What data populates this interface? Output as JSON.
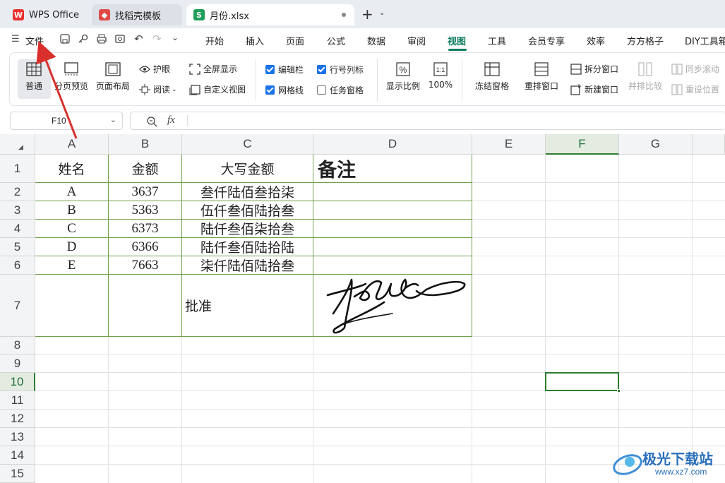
{
  "tabs": [
    {
      "label": "WPS Office",
      "icon": "wps-logo-icon"
    },
    {
      "label": "找稻壳模板",
      "icon": "daoke-icon"
    },
    {
      "label": "月份.xlsx",
      "icon": "sheet-s-icon"
    }
  ],
  "menus": {
    "file": "文件",
    "items": [
      "开始",
      "插入",
      "页面",
      "公式",
      "数据",
      "审阅",
      "视图",
      "工具",
      "会员专享",
      "效率",
      "方方格子",
      "DIY工具箱"
    ],
    "active": "视图"
  },
  "ribbon": {
    "normal": "普通",
    "page_break": "分页预览",
    "page_layout": "页面布局",
    "eye_protect": "护眼",
    "reading": "阅读",
    "fullscreen": "全屏显示",
    "custom_view": "自定义视图",
    "edit_bar": "编辑栏",
    "headings": "行号列标",
    "gridlines": "网格线",
    "task_pane": "任务窗格",
    "zoom": "显示比例",
    "zoom100": "100%",
    "freeze": "冻结窗格",
    "rearrange": "重排窗口",
    "split": "拆分窗口",
    "new_window": "新建窗口",
    "side_by_side": "并排比较",
    "sync_scroll": "同步滚动",
    "reset_pos": "重设位置"
  },
  "checks": {
    "edit_bar": true,
    "headings": true,
    "gridlines": true,
    "task_pane": false
  },
  "namebox": "F10",
  "fx": "fx",
  "columns": [
    "A",
    "B",
    "C",
    "D",
    "E",
    "F",
    "G"
  ],
  "rows": [
    "1",
    "2",
    "3",
    "4",
    "5",
    "6",
    "7",
    "8",
    "9",
    "10",
    "11",
    "12",
    "13",
    "14",
    "15"
  ],
  "selected_cell": "F10",
  "table": {
    "headers": [
      "姓名",
      "金额",
      "大写金额",
      "备注"
    ],
    "data": [
      [
        "A",
        "3637",
        "叁仟陆佰叁拾柒",
        ""
      ],
      [
        "B",
        "5363",
        "伍仟叁佰陆拾叁",
        ""
      ],
      [
        "C",
        "6373",
        "陆仟叁佰柒拾叁",
        ""
      ],
      [
        "D",
        "6366",
        "陆仟叁佰陆拾陆",
        ""
      ],
      [
        "E",
        "7663",
        "柒仟陆佰陆拾叁",
        ""
      ]
    ],
    "approve": "批准"
  },
  "watermark": {
    "cn": "极光下载站",
    "url": "www.xz7.com"
  },
  "colors": {
    "accent": "#1a73e8",
    "active_tab": "#0f7b5f",
    "green_border": "#6fa04c",
    "annotation_arrow": "#d9302c",
    "wps_red": "#e8312f",
    "sheet_green": "#1e9e5a"
  }
}
